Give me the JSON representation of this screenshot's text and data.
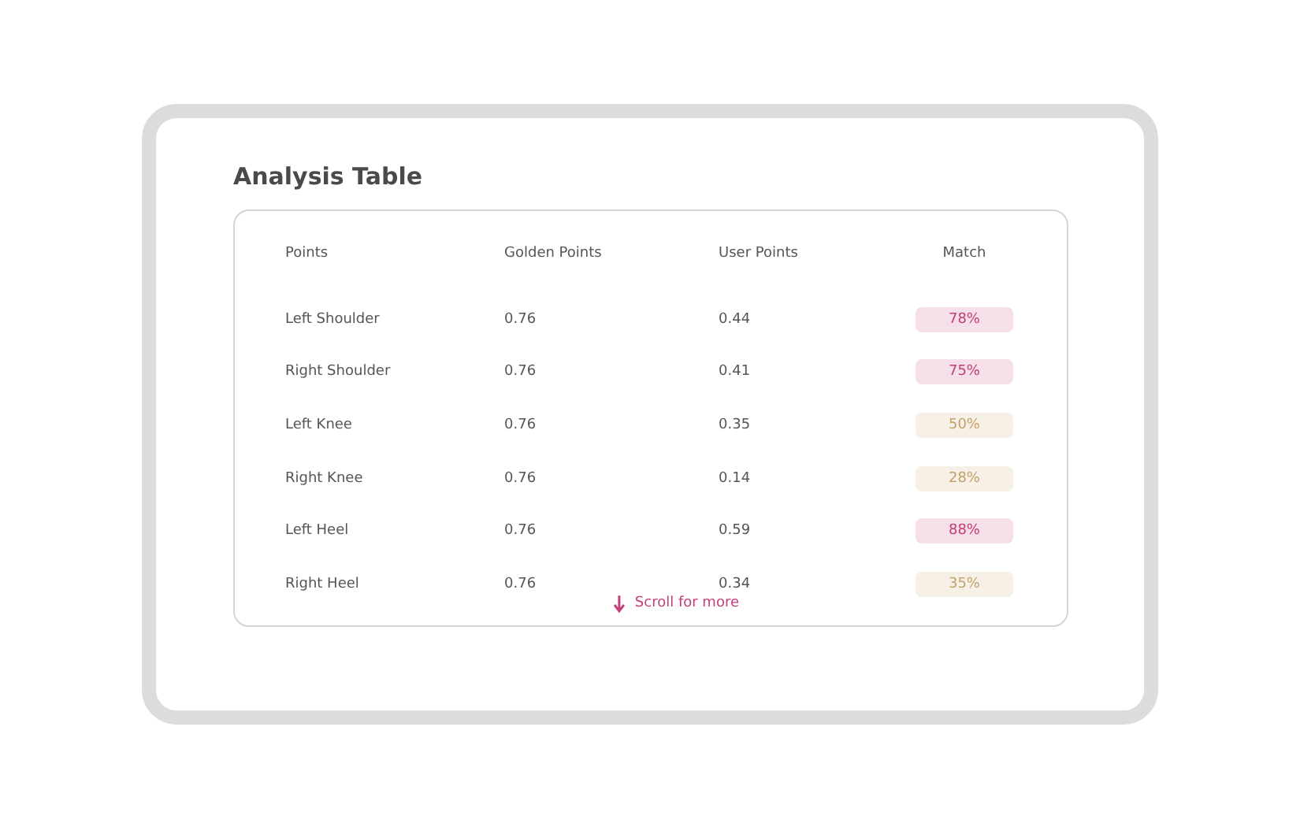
{
  "title": "Analysis Table",
  "table": {
    "columns": [
      "Points",
      "Golden Points",
      "User Points",
      "Match"
    ],
    "rows": [
      {
        "point": "Left Shoulder",
        "golden": "0.76",
        "user": "0.44",
        "match": {
          "text": "78%",
          "color": "#c2407a"
        }
      },
      {
        "point": "Right Shoulder",
        "golden": "0.76",
        "user": "0.41",
        "match": {
          "text": "75%",
          "color": "#c2407a"
        }
      },
      {
        "point": "Left Knee",
        "golden": "0.76",
        "user": "0.35",
        "match": {
          "text": "50%",
          "color": "#c4a36a"
        }
      },
      {
        "point": "Right Knee",
        "golden": "0.76",
        "user": "0.14",
        "match": {
          "text": "28%",
          "color": "#c4a36a"
        }
      },
      {
        "point": "Left Heel",
        "golden": "0.76",
        "user": "0.59",
        "match": {
          "text": "88%",
          "color": "#c2407a"
        }
      },
      {
        "point": "Right Heel",
        "golden": "0.76",
        "user": "0.34",
        "match": {
          "text": "35%",
          "color": "#c4a36a"
        }
      }
    ]
  },
  "scroll_hint": "Scroll for more"
}
